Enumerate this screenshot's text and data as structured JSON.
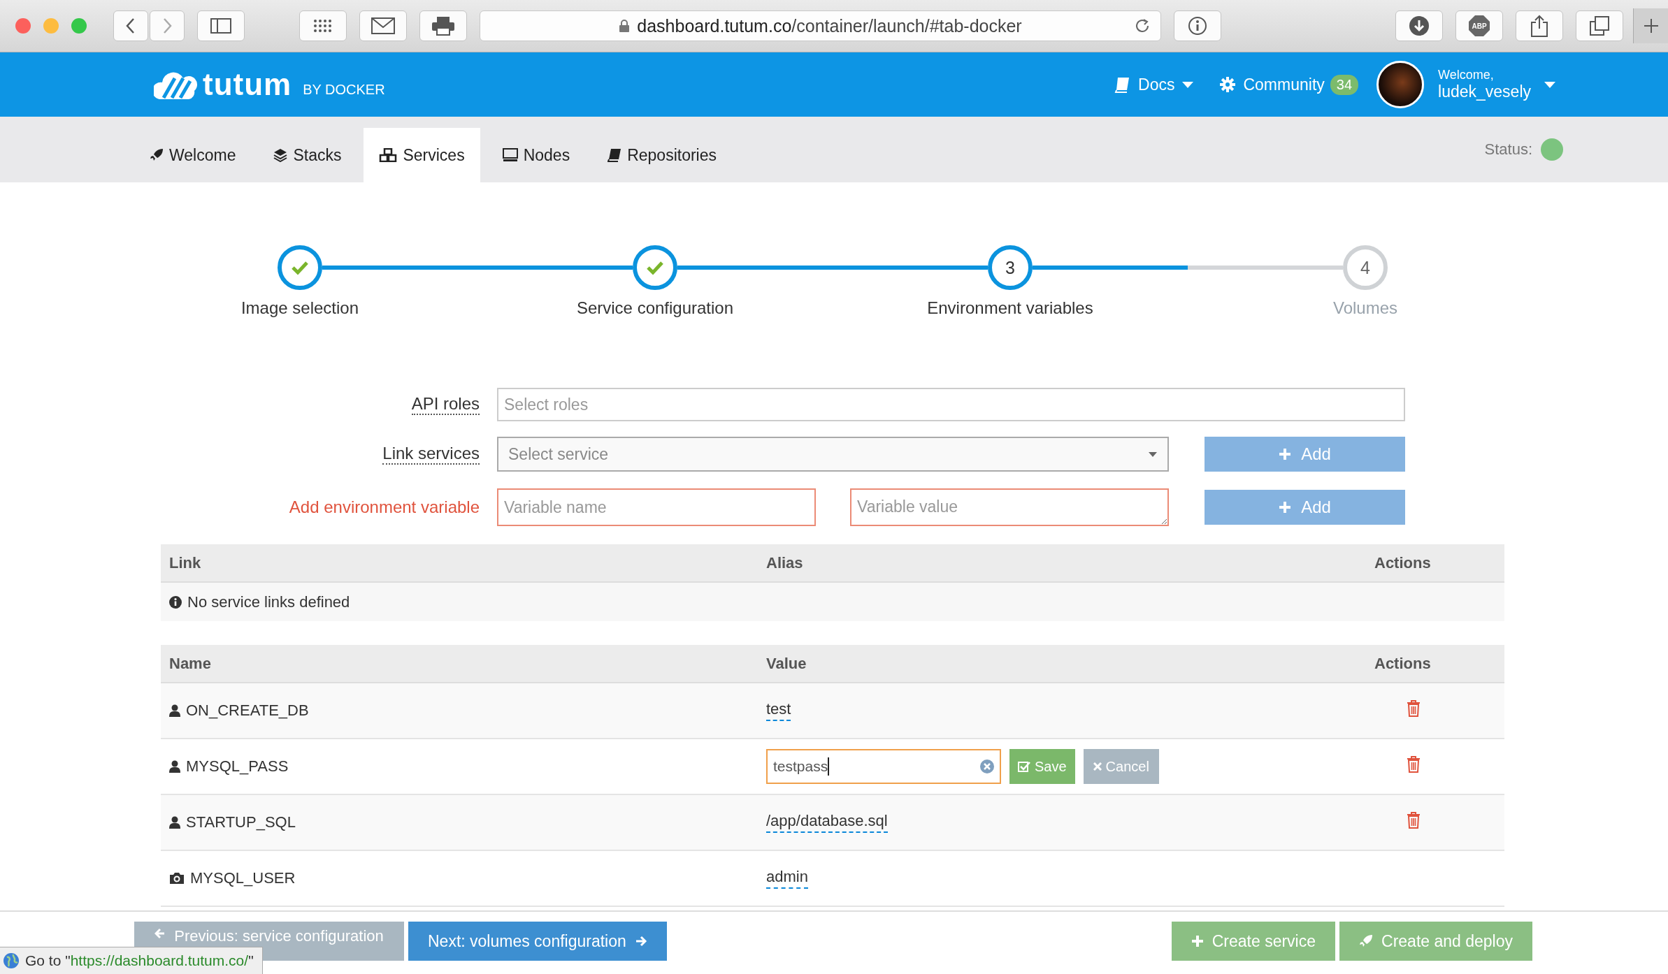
{
  "browser": {
    "url_host": "dashboard.tutum.co",
    "url_path": "/container/launch/#tab-docker",
    "adblock_label": "ABP"
  },
  "header": {
    "logo": "tutum",
    "logo_suffix": "BY DOCKER",
    "docs": "Docs",
    "community": "Community",
    "community_count": "34",
    "welcome": "Welcome,",
    "username": "ludek_vesely"
  },
  "tabs": [
    {
      "label": "Welcome",
      "kind": "rocket",
      "selected": false
    },
    {
      "label": "Stacks",
      "kind": "layers",
      "selected": false
    },
    {
      "label": "Services",
      "kind": "cubes",
      "selected": true
    },
    {
      "label": "Nodes",
      "kind": "monitor",
      "selected": false
    },
    {
      "label": "Repositories",
      "kind": "book",
      "selected": false
    }
  ],
  "status": {
    "label": "Status:"
  },
  "steps": [
    {
      "label": "Image selection",
      "completed": true,
      "reached": true
    },
    {
      "label": "Service configuration",
      "completed": true,
      "reached": true
    },
    {
      "label": "Environment variables",
      "completed": false,
      "reached": true,
      "number": "3"
    },
    {
      "label": "Volumes",
      "completed": false,
      "reached": false,
      "number": "4"
    }
  ],
  "form": {
    "api_roles_label": "API roles",
    "api_roles_placeholder": "Select roles",
    "link_services_label": "Link services",
    "link_services_placeholder": "Select service",
    "link_add": "Add",
    "env_label": "Add environment variable",
    "var_name_placeholder": "Variable name",
    "var_value_placeholder": "Variable value",
    "env_add": "Add"
  },
  "links_table": {
    "columns": [
      "Link",
      "Alias",
      "Actions"
    ],
    "empty": "No service links defined"
  },
  "env_table": {
    "columns": [
      "Name",
      "Value",
      "Actions"
    ],
    "rows": [
      {
        "kind": "user",
        "name": "ON_CREATE_DB",
        "value": "test",
        "editing": false
      },
      {
        "kind": "user",
        "name": "MYSQL_PASS",
        "value": "testpass",
        "editing": true,
        "save": "Save",
        "cancel": "Cancel"
      },
      {
        "kind": "user",
        "name": "STARTUP_SQL",
        "value": "/app/database.sql",
        "editing": false
      },
      {
        "kind": "image",
        "name": "MYSQL_USER",
        "value": "admin",
        "editing": false
      }
    ]
  },
  "footer": {
    "previous": "Previous: service configuration",
    "next": "Next: volumes configuration",
    "create": "Create service",
    "deploy": "Create and deploy"
  },
  "status_tip": {
    "prefix": "Go to \"",
    "url": "https://dashboard.tutum.co/",
    "suffix": "\""
  }
}
